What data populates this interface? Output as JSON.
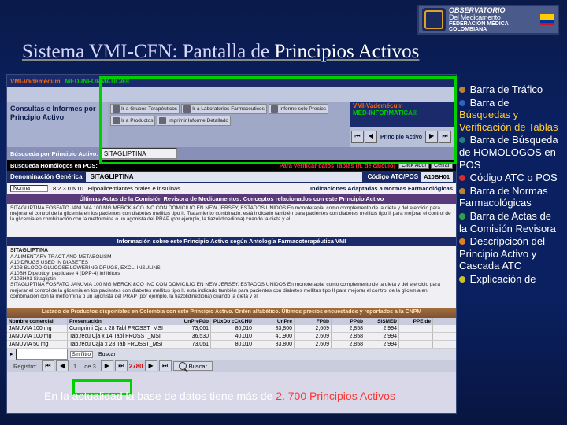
{
  "header": {
    "logo_line1": "OBSERVATORIO",
    "logo_line2": "Del Medicamento",
    "logo_line3": "FEDERACIÓN MÉDICA COLOMBIANA"
  },
  "title_a": "Sistema VMI-CFN: Pantalla de ",
  "title_b": "Principios Activos",
  "vmi": {
    "v": "VMI-Vademécum",
    "med": "MED-INFORMATICA®"
  },
  "consultas_label": "Consultas e Informes por Principio Activo",
  "buttons": {
    "grupos": "Ir a Grupos Terapéuticos",
    "lab": "Ir a Laboratorios Farmacéuticos",
    "prod": "Ir a Productos",
    "imprimir": "Imprimir Informe Detallado",
    "informe": "Informe solo Precios",
    "click": "Click Aquí",
    "cerrar": "Cerrar"
  },
  "nav_label": "Principio Activo",
  "search": {
    "busqueda": "Búsqueda por Principio Activo:",
    "busqueda_val": "SITAGLIPTINA",
    "homologos": "Búsqueda Homólogos en POS:"
  },
  "verif": "Para verificar datos Tablas (h. de cálculo)",
  "denom": {
    "label": "Denominación Genérica",
    "val": "SITAGLIPTINA",
    "atc_l": "Código ATC/POS",
    "atc_v": "A10BH01"
  },
  "norma": {
    "sel": "Norma",
    "l1": "8.2.3.0.N10",
    "l2": "Hipoalicemiantes orales e insulinas",
    "ind": "Indicaciones Adaptadas a Normas Farmacológicas"
  },
  "bands": {
    "actas": "Últimas Actas de la Comisión Revisora de Medicamentos: Conceptos relacionados con este Principio Activo",
    "info": "Información sobre este Principio Activo según Antología Farmacoterapéutica VMI",
    "listado": "Listado de Productos disponibles en Colombia con este Principio Activo. Orden alfabético. Últimos precios encuestados y reportados a la CNPM"
  },
  "actas_text": "SITAGLIPTINA FOSFATO JANUVIA 100 MG MERCK &CO INC CON DOMICILIO EN NEW JERSEY, ESTADOS UNIDOS En monoterapia, como complemento de la dieta y del ejercicio para mejorar el control de la glicemia en los pacientes con diabetes mellitus tipo II. Tratamiento combinado: está indicado también para pacientes con diabetes mellitus tipo II para mejorar el control de la glicemia en combinación con la metformina o un agonista del PRAP (por ejemplo, la tiazolidinediona) cuando la dieta y el",
  "info_text": {
    "t": "SITAGLIPTINA",
    "l1": "A ALIMENTARY TRACT AND METABOLISM",
    "l2": "A10 DRUGS USED IN DIABETES",
    "l3": "A10B BLOOD GLUCOSE LOWERING DRUGS, EXCL. INSULINS",
    "l4": "A10BH Dipeptidyl peptidase 4 (DPP-4) inhibitors",
    "l5": "A10BH01 Sitagliptin",
    "l6": "SITAGLIPTINA FOSFATO JANUVIA 100 MG MERCK &CO INC CON DOMICILIO EN NEW JERSEY, ESTADOS UNIDOS En monoterapia, como complemento de la dieta y del ejercicio para mejorar el control de la glicemia en los pacientes con diabetes mellitus tipo II. esta indicado también para pacientes con diabetes mellitus tipo II para mejorar el control de la glicemia en combinación con la metformina o un agonista del PRAP (por ejemplo, la tiazolidinediona) cuando la dieta y el"
  },
  "thead": {
    "nom": "Nombre comercial",
    "pres": "Presentación",
    "p1": "UnPrePúb",
    "p2": "PUxDo cCkCHU",
    "p3": "UnPre",
    "p4": "FPúb",
    "p5": "PPúb",
    "p6": "SISMED",
    "p7": "PPE de"
  },
  "rows": [
    {
      "nom": "JANUVIA 100 mg",
      "pres": "Comprimi Cja x 28 Tabl FROSST_MSI",
      "p1": "73,061",
      "p2": "80,010",
      "p3": "83,800",
      "p4": "2,609",
      "p5": "2,858",
      "p6": "2,994",
      "p7": ""
    },
    {
      "nom": "JANUVIA 100 mg",
      "pres": "Tab.recu Cja x 14 Tabl FROSST_MSI",
      "p1": "36,530",
      "p2": "40,010",
      "p3": "41,900",
      "p4": "2,609",
      "p5": "2,858",
      "p6": "2,994",
      "p7": ""
    },
    {
      "nom": "JANUVIA 50 mg",
      "pres": "Tab.recu Caja x 28 Tab FROSST_MSI",
      "p1": "73,061",
      "p2": "80,010",
      "p3": "83,800",
      "p4": "2,609",
      "p5": "2,858",
      "p6": "2,994",
      "p7": ""
    }
  ],
  "filter_label": "Sin filtro",
  "nav_bottom": {
    "reg": "Registro:",
    "pos": "1",
    "of": "de 3",
    "total": "2780",
    "buscar": "Buscar"
  },
  "caption_a": "En la actualidad la base de datos tiene más de ",
  "caption_b": "2. 700 Principios Activos",
  "side": [
    {
      "c": "b-brown",
      "t": "Barra de Tráfico"
    },
    {
      "c": "b-blue",
      "t": "Barra de",
      "hl": "Búsquedas  y Verificación de Tablas"
    },
    {
      "c": "b-teal",
      "t": "Barra de Búsqueda de HOMOLOGOS en POS"
    },
    {
      "c": "b-red",
      "t": "Código ATC o POS"
    },
    {
      "c": "b-brown",
      "t": "Barra de Normas Farmacológicas"
    },
    {
      "c": "b-green",
      "t": "Barra de Actas de la Comisión Revisora"
    },
    {
      "c": "b-orange",
      "t": "Descripcicón del Principio Activo y Cascada ATC"
    },
    {
      "c": "b-yellow",
      "t": "Explicación de"
    }
  ]
}
